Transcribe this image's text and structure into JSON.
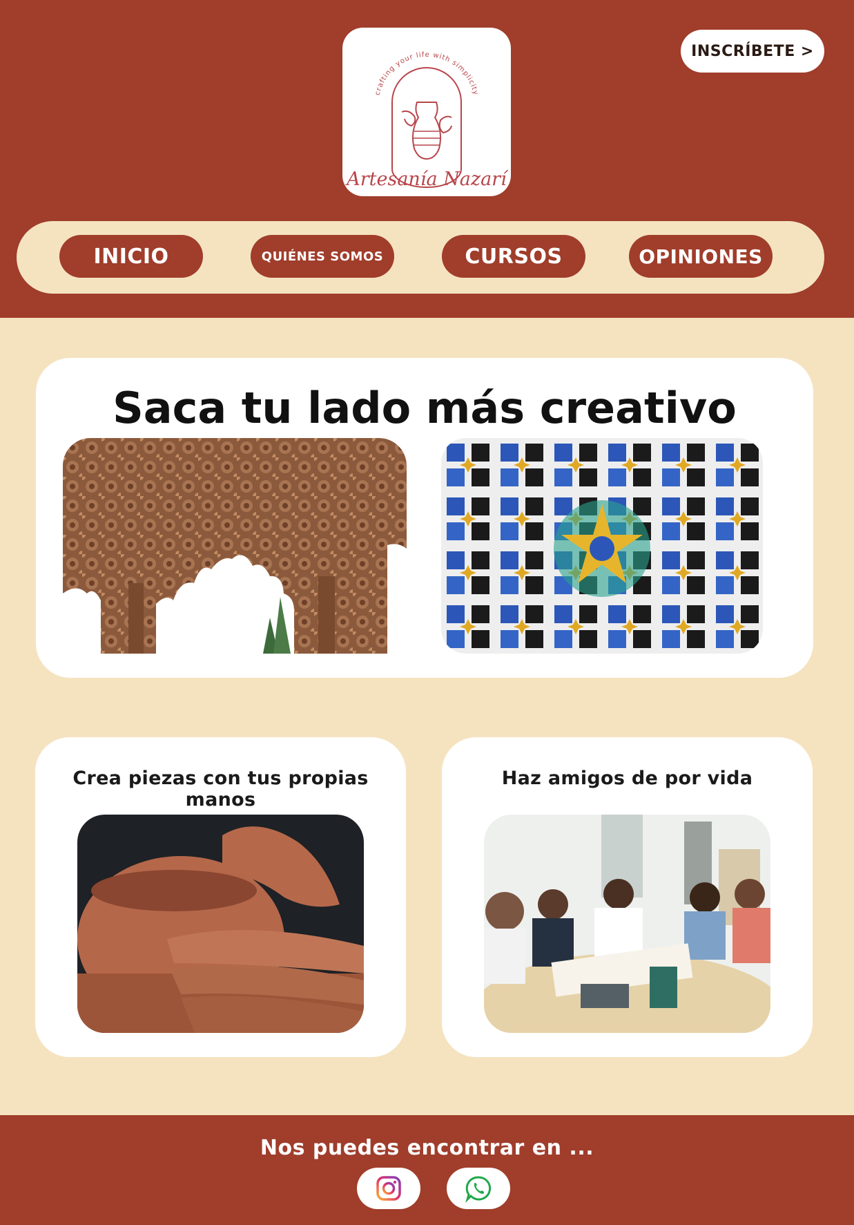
{
  "header": {
    "logo": {
      "brand_name": "Artesanía Nazarí",
      "tagline": "crafting your life with simplicity",
      "icon": "pottery-hands-logo"
    },
    "signup_label": "INSCRÍBETE >",
    "colors": {
      "brand": "#a03d2b",
      "cream": "#f5e3c0"
    }
  },
  "nav": {
    "items": [
      {
        "label": "INICIO"
      },
      {
        "label": "QUIÉNES SOMOS"
      },
      {
        "label": "CURSOS"
      },
      {
        "label": "OPINIONES"
      }
    ]
  },
  "hero": {
    "title": "Saca tu lado más creativo",
    "images": [
      "alhambra-arches-photo",
      "zellige-tile-pattern-photo"
    ]
  },
  "features": [
    {
      "title": "Crea piezas con tus propias manos",
      "image": "pottery-wheel-hands-photo"
    },
    {
      "title": "Haz amigos de por vida",
      "image": "group-crafting-workshop-photo"
    }
  ],
  "footer": {
    "text": "Nos puedes encontrar en ...",
    "social": [
      "instagram-icon",
      "whatsapp-icon"
    ]
  }
}
